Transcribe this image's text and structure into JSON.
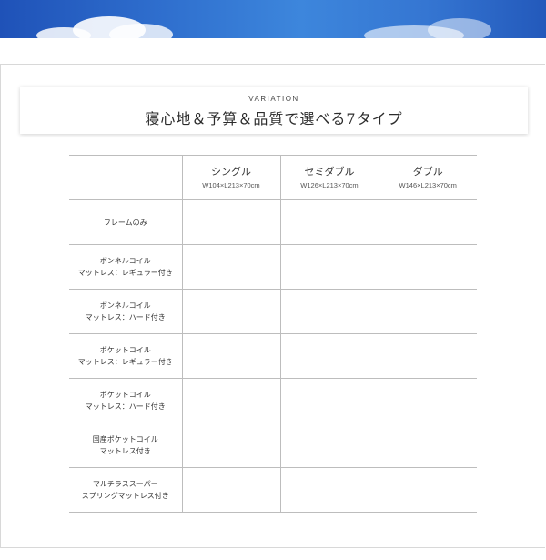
{
  "banner": {
    "colors": {
      "sky_dark": "#1f52b8",
      "sky_light": "#3d86dc",
      "cloud": "#ffffff"
    }
  },
  "heading": {
    "subtitle": "VARIATION",
    "title": "寝心地＆予算＆品質で選べる7タイプ"
  },
  "table": {
    "columns": [
      {
        "name": "シングル",
        "size": "W104×L213×70cm"
      },
      {
        "name": "セミダブル",
        "size": "W126×L213×70cm"
      },
      {
        "name": "ダブル",
        "size": "W146×L213×70cm"
      }
    ],
    "rows": [
      {
        "line1": "フレームのみ",
        "line2": ""
      },
      {
        "line1": "ボンネルコイル",
        "line2": "マットレス：レギュラー付き"
      },
      {
        "line1": "ボンネルコイル",
        "line2": "マットレス：ハード付き"
      },
      {
        "line1": "ポケットコイル",
        "line2": "マットレス：レギュラー付き"
      },
      {
        "line1": "ポケットコイル",
        "line2": "マットレス：ハード付き"
      },
      {
        "line1": "国産ポケットコイル",
        "line2": "マットレス付き"
      },
      {
        "line1": "マルチラススーパー",
        "line2": "スプリングマットレス付き"
      }
    ]
  }
}
